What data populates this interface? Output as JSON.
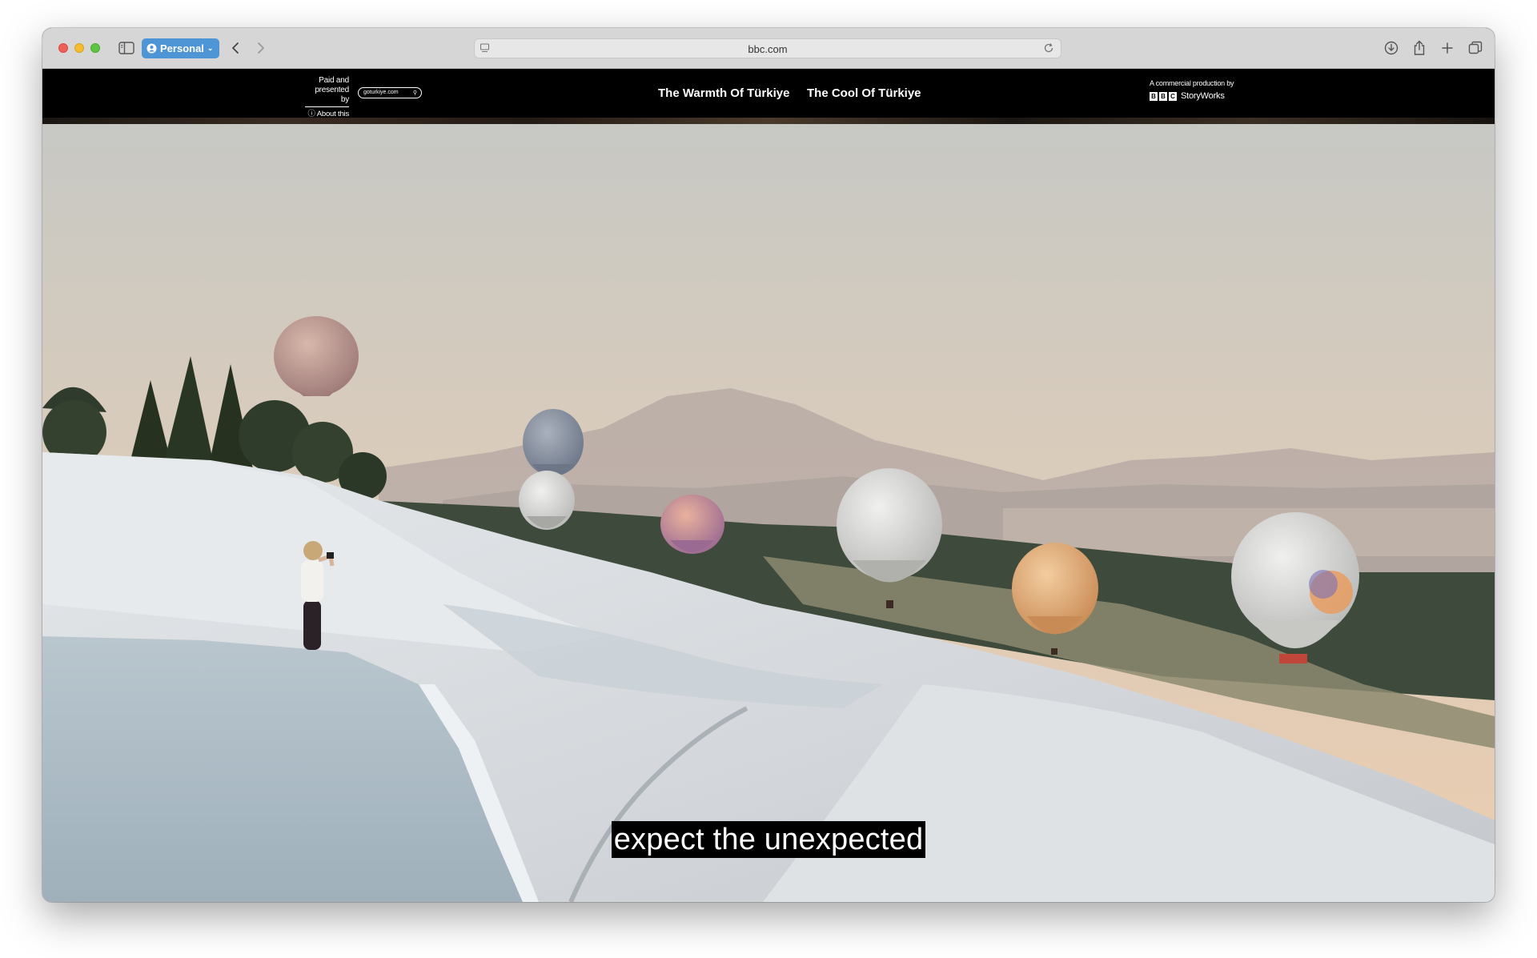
{
  "browser": {
    "profile_label": "Personal",
    "url": "bbc.com"
  },
  "header": {
    "sponsor_line1": "Paid and",
    "sponsor_line2": "presented by",
    "about_label": "ⓘ About this",
    "sponsor_logo": "goturkiye.com",
    "nav": [
      {
        "label": "The Warmth Of Türkiye"
      },
      {
        "label": "The Cool Of Türkiye"
      }
    ],
    "producer_label": "A commercial production by",
    "producer_logo": {
      "letters": [
        "B",
        "B",
        "C"
      ],
      "name": "StoryWorks"
    }
  },
  "video": {
    "subtitle": "expect the unexpected"
  },
  "colors": {
    "sky_top": "#c9c9c6",
    "sky_bottom": "#e6cdb3",
    "travertine": "#d6d9dc",
    "water": "#aab8c2",
    "profile_blue": "#4e95d6"
  }
}
